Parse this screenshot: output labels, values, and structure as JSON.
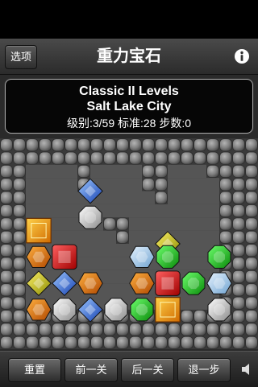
{
  "nav": {
    "menu_label": "选项",
    "title": "重力宝石",
    "info_icon": "info-icon"
  },
  "level": {
    "title": "Classic II Levels",
    "name": "Salt Lake City",
    "stats": "级别:3/59  标准:28  步数:0"
  },
  "toolbar": {
    "reset": "重置",
    "prev": "前一关",
    "next": "后一关",
    "undo": "退一步",
    "sound_icon": "speaker-icon"
  },
  "board": {
    "cols": 20,
    "rows": 16,
    "floor": [
      "....................",
      "..........,.........",
      "..............,.....",
      "....................",
      "....................",
      "....................",
      "....................",
      "....................",
      "....................",
      "....................",
      "....................",
      "....................",
      "....................",
      "....................",
      "....................",
      "...................."
    ],
    "wall_rows": [
      "####################",
      "####################",
      "##....#....##...####",
      "##....#....##....###",
      "##..........#....###",
      "##...............###",
      "##......##.......###",
      "##.......#.......###",
      "##...............###",
      "##...............###",
      "##...............###",
      "##...............###",
      "##...............###",
      "####################",
      "####################",
      "####################"
    ],
    "gems": [
      {
        "type": "blue-diamond",
        "col": 6,
        "row": 3
      },
      {
        "type": "white-octagon",
        "col": 6,
        "row": 5
      },
      {
        "type": "orange-square",
        "col": 2,
        "row": 6
      },
      {
        "type": "yellow-diamond",
        "col": 12,
        "row": 7
      },
      {
        "type": "orange-hexagon",
        "col": 2,
        "row": 8
      },
      {
        "type": "red-square",
        "col": 4,
        "row": 8
      },
      {
        "type": "light-blue-hexagon",
        "col": 10,
        "row": 8
      },
      {
        "type": "green-octagon",
        "col": 12,
        "row": 8
      },
      {
        "type": "green-octagon",
        "col": 16,
        "row": 8
      },
      {
        "type": "yellow-diamond",
        "col": 2,
        "row": 10
      },
      {
        "type": "blue-diamond",
        "col": 4,
        "row": 10
      },
      {
        "type": "orange-hexagon",
        "col": 6,
        "row": 10
      },
      {
        "type": "orange-hexagon",
        "col": 10,
        "row": 10
      },
      {
        "type": "red-square",
        "col": 12,
        "row": 10
      },
      {
        "type": "green-octagon",
        "col": 14,
        "row": 10
      },
      {
        "type": "light-blue-hexagon",
        "col": 16,
        "row": 10
      },
      {
        "type": "orange-hexagon",
        "col": 2,
        "row": 12
      },
      {
        "type": "white-octagon",
        "col": 4,
        "row": 12
      },
      {
        "type": "blue-diamond",
        "col": 6,
        "row": 12
      },
      {
        "type": "white-octagon",
        "col": 8,
        "row": 12
      },
      {
        "type": "green-octagon",
        "col": 10,
        "row": 12
      },
      {
        "type": "orange-square",
        "col": 12,
        "row": 12
      },
      {
        "type": "white-octagon",
        "col": 16,
        "row": 12
      }
    ],
    "blocks": [
      {
        "col": 6,
        "row": 10
      },
      {
        "col": 10,
        "row": 2
      },
      {
        "col": 6,
        "row": 6
      },
      {
        "col": 14,
        "row": 12
      }
    ]
  }
}
